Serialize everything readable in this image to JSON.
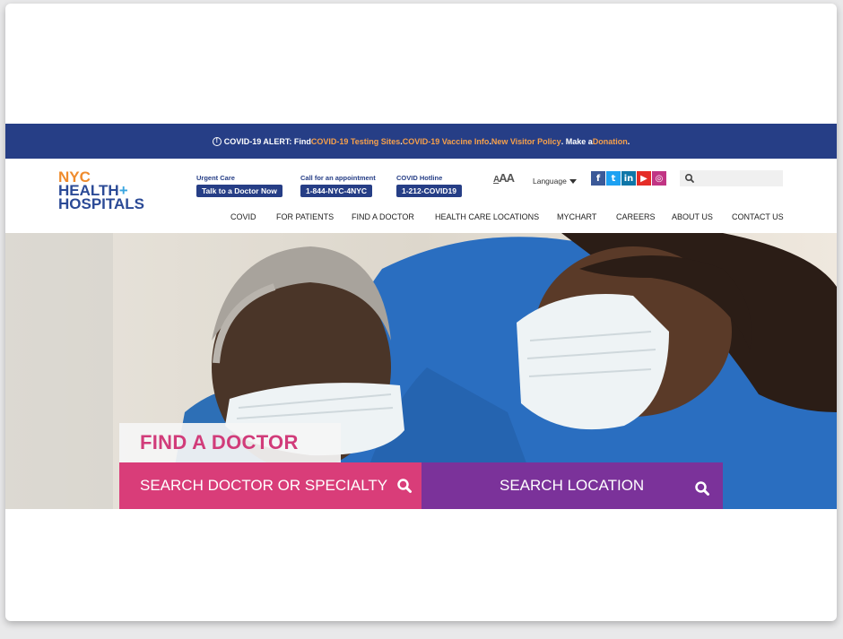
{
  "alert": {
    "prefix": "COVID-19 ALERT: Find ",
    "link1": "COVID-19 Testing Sites",
    "sep1": ". ",
    "link2": "COVID-19 Vaccine Info",
    "sep2": ". ",
    "link3": "New Visitor Policy",
    "mid": ". Make a ",
    "link4": "Donation",
    "end": "."
  },
  "logo": {
    "nyc": "NYC",
    "health": "HEALTH",
    "plus": "+",
    "hospitals": "HOSPITALS"
  },
  "utility": {
    "urgent_caption": "Urgent Care",
    "urgent_button": "Talk to a Doctor Now",
    "appt_caption": "Call for an appointment",
    "appt_button": "1-844-NYC-4NYC",
    "hotline_caption": "COVID Hotline",
    "hotline_button": "1-212-COVID19"
  },
  "text_size": {
    "small": "A",
    "large": "AA"
  },
  "language_label": "Language",
  "social": [
    {
      "icon": "facebook-icon",
      "glyph": "f",
      "color": "#3b5998"
    },
    {
      "icon": "twitter-icon",
      "glyph": "t",
      "color": "#1da1f2"
    },
    {
      "icon": "linkedin-icon",
      "glyph": "in",
      "color": "#0e76a8"
    },
    {
      "icon": "youtube-icon",
      "glyph": "▶",
      "color": "#e52d27"
    },
    {
      "icon": "instagram-icon",
      "glyph": "◎",
      "color": "#c13584"
    }
  ],
  "search": {
    "placeholder": ""
  },
  "nav": [
    "COVID",
    "FOR PATIENTS",
    "FIND A DOCTOR",
    "HEALTH CARE LOCATIONS",
    "MYCHART",
    "CAREERS",
    "ABOUT US",
    "CONTACT US"
  ],
  "hero": {
    "find_doctor": "FIND A DOCTOR",
    "search_doctor": "SEARCH DOCTOR OR SPECIALTY",
    "search_location": "SEARCH LOCATION"
  },
  "colors": {
    "brand_blue": "#263e86",
    "alert_link": "#f6a04b",
    "pink": "#d93d79",
    "purple": "#7b329a"
  }
}
